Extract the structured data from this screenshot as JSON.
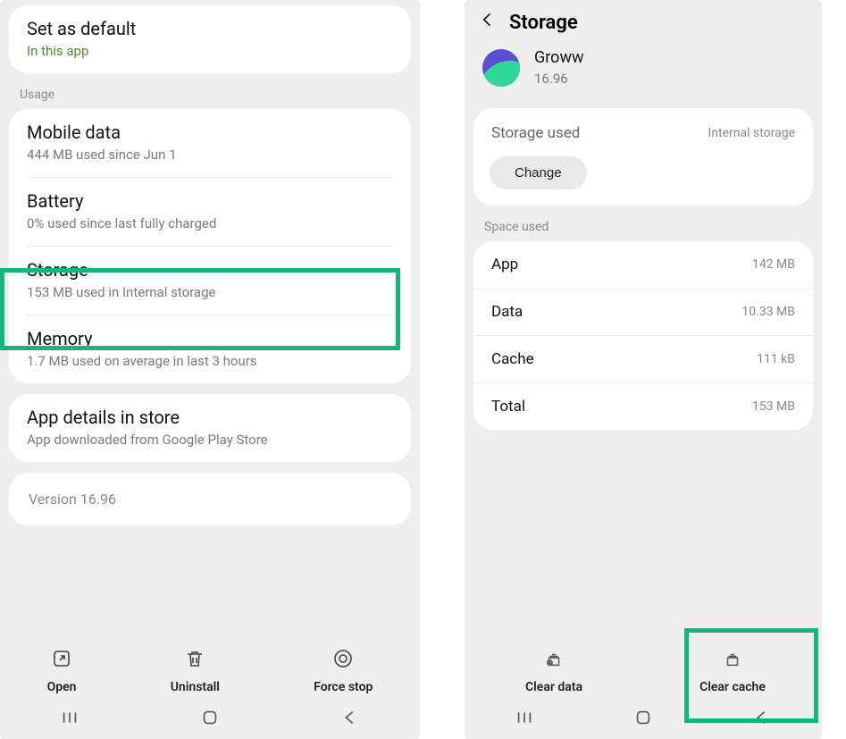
{
  "left": {
    "defaults": {
      "title": "Set as default",
      "sub": "In this app"
    },
    "usageLabel": "Usage",
    "mobileData": {
      "title": "Mobile data",
      "sub": "444 MB used since Jun 1"
    },
    "battery": {
      "title": "Battery",
      "sub": "0% used since last fully charged"
    },
    "storage": {
      "title": "Storage",
      "sub": "153 MB used in Internal storage"
    },
    "memory": {
      "title": "Memory",
      "sub": "1.7 MB used on average in last 3 hours"
    },
    "appDetails": {
      "title": "App details in store",
      "sub": "App downloaded from Google Play Store"
    },
    "version": "Version 16.96",
    "actions": {
      "open": "Open",
      "uninstall": "Uninstall",
      "forceStop": "Force stop"
    }
  },
  "right": {
    "headerTitle": "Storage",
    "app": {
      "name": "Groww",
      "version": "16.96"
    },
    "storageUsed": {
      "label": "Storage used",
      "value": "Internal storage",
      "changeLabel": "Change"
    },
    "spaceUsedLabel": "Space used",
    "rows": {
      "app": {
        "label": "App",
        "value": "142 MB"
      },
      "data": {
        "label": "Data",
        "value": "10.33 MB"
      },
      "cache": {
        "label": "Cache",
        "value": "111 kB"
      },
      "total": {
        "label": "Total",
        "value": "153 MB"
      }
    },
    "actions": {
      "clearData": "Clear data",
      "clearCache": "Clear cache"
    }
  }
}
